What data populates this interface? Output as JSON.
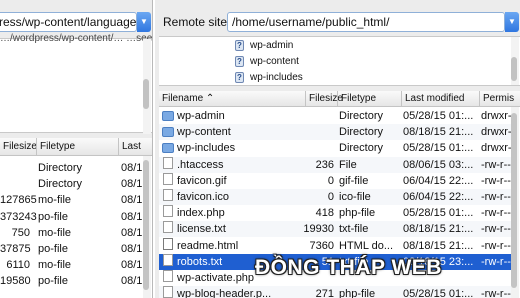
{
  "local_site": {
    "path": "ress/wp-content/languages",
    "tree_partial_text": "…/wordpress/wp-content/…  …seedeeds…"
  },
  "local_list": {
    "columns": [
      "Filesize",
      "Filetype",
      "Last"
    ],
    "rows": [
      {
        "size": "",
        "type": "Directory",
        "mod": "08/1"
      },
      {
        "size": "",
        "type": "Directory",
        "mod": "08/1"
      },
      {
        "size": "127865",
        "type": "mo-file",
        "mod": "08/1"
      },
      {
        "size": "373243",
        "type": "po-file",
        "mod": "08/1"
      },
      {
        "size": "750",
        "type": "mo-file",
        "mod": "08/1"
      },
      {
        "size": "37875",
        "type": "po-file",
        "mod": "08/1"
      },
      {
        "size": "6110",
        "type": "mo-file",
        "mod": "08/1"
      },
      {
        "size": "19580",
        "type": "po-file",
        "mod": "08/1"
      }
    ]
  },
  "remote_site": {
    "label": "Remote site:",
    "path": "/home/username/public_html/",
    "tree": [
      "wp-admin",
      "wp-content",
      "wp-includes"
    ]
  },
  "remote_list": {
    "columns": {
      "name": "Filename",
      "size": "Filesize",
      "type": "Filetype",
      "modified": "Last modified",
      "perms": "Permis"
    },
    "rows": [
      {
        "icon": "folder",
        "name": "wp-admin",
        "size": "",
        "type": "Directory",
        "modified": "05/28/15 01:...",
        "perms": "drwxr-"
      },
      {
        "icon": "folder",
        "name": "wp-content",
        "size": "",
        "type": "Directory",
        "modified": "08/18/15 21:...",
        "perms": "drwxr-"
      },
      {
        "icon": "folder",
        "name": "wp-includes",
        "size": "",
        "type": "Directory",
        "modified": "05/28/15 01:...",
        "perms": "drwxr-"
      },
      {
        "icon": "file",
        "name": ".htaccess",
        "size": "236",
        "type": "File",
        "modified": "08/06/15 03:...",
        "perms": "-rw-r--"
      },
      {
        "icon": "file",
        "name": "favicon.gif",
        "size": "0",
        "type": "gif-file",
        "modified": "06/04/15 22:...",
        "perms": "-rw-r--"
      },
      {
        "icon": "file",
        "name": "favicon.ico",
        "size": "0",
        "type": "ico-file",
        "modified": "06/04/15 22:...",
        "perms": "-rw-r--"
      },
      {
        "icon": "file",
        "name": "index.php",
        "size": "418",
        "type": "php-file",
        "modified": "05/28/15 01:...",
        "perms": "-rw-r--"
      },
      {
        "icon": "file",
        "name": "license.txt",
        "size": "19930",
        "type": "txt-file",
        "modified": "08/18/15 21:...",
        "perms": "-rw-r--"
      },
      {
        "icon": "img",
        "name": "readme.html",
        "size": "7360",
        "type": "HTML do...",
        "modified": "08/18/15 21:...",
        "perms": "-rw-r--"
      },
      {
        "icon": "file",
        "name": "robots.txt",
        "size": "51",
        "type": "txt-file",
        "modified": "08/18/15 23:...",
        "perms": "-rw-r--"
      },
      {
        "icon": "file",
        "name": "wp-activate.php",
        "size": "",
        "type": "",
        "modified": "",
        "perms": ""
      },
      {
        "icon": "file",
        "name": "wp-blog-header.p...",
        "size": "271",
        "type": "php-file",
        "modified": "05/28/15 01:...",
        "perms": "-rw-r--"
      }
    ],
    "selected_index": 9
  },
  "watermark": "ĐỒNG THÁP WEB"
}
